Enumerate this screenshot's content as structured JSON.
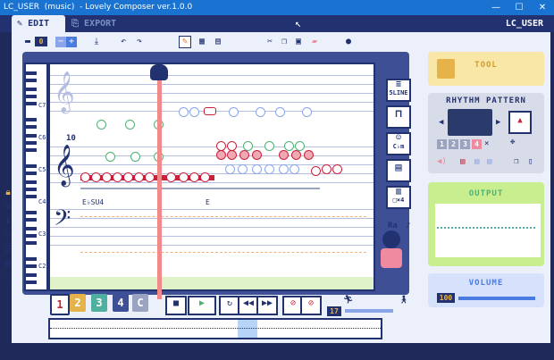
{
  "window": {
    "title": "LC_USER  (music)  - Lovely Composer ver.1.0.0",
    "min": "—",
    "max": "☐",
    "close": "✕"
  },
  "tabs": [
    {
      "label": "EDIT"
    },
    {
      "label": "EXPORT"
    }
  ],
  "user": "LC_USER",
  "toolbar": {
    "counter": "0"
  },
  "palette_counter": "0",
  "score": {
    "octaves": [
      "C7",
      "C6",
      "C5",
      "C4",
      "C3",
      "C2"
    ],
    "measure_number": "10",
    "chord_label_1": "E♭SU4",
    "chord_label_2": "E"
  },
  "side_buttons": [
    {
      "label": "5LINE"
    },
    {
      "label": ""
    },
    {
      "label": "C♭m"
    },
    {
      "label": ""
    },
    {
      "label": "□×4"
    }
  ],
  "ra_label": "Ra",
  "tracks": [
    {
      "label": "1",
      "color": "#ffffff",
      "text": "#c8213c"
    },
    {
      "label": "2",
      "color": "#e6b34a",
      "text": "#ffffff"
    },
    {
      "label": "3",
      "color": "#4fb0a0",
      "text": "#ffffff"
    },
    {
      "label": "4",
      "color": "#3e4f95",
      "text": "#ffffff"
    },
    {
      "label": "C",
      "color": "#9aa3bf",
      "text": "#ffffff"
    }
  ],
  "tempo_value": "17",
  "right": {
    "tool": {
      "title": "TOOL"
    },
    "rhythm": {
      "title": "RHYTHM PATTERN",
      "numbers": [
        "1",
        "2",
        "3",
        "4"
      ]
    },
    "output": {
      "title": "OUTPUT"
    },
    "volume": {
      "title": "VOLUME",
      "value": "100"
    }
  },
  "colors": {
    "accent": "#1a73d1",
    "navy": "#223271",
    "panel": "#ecf0fb"
  }
}
